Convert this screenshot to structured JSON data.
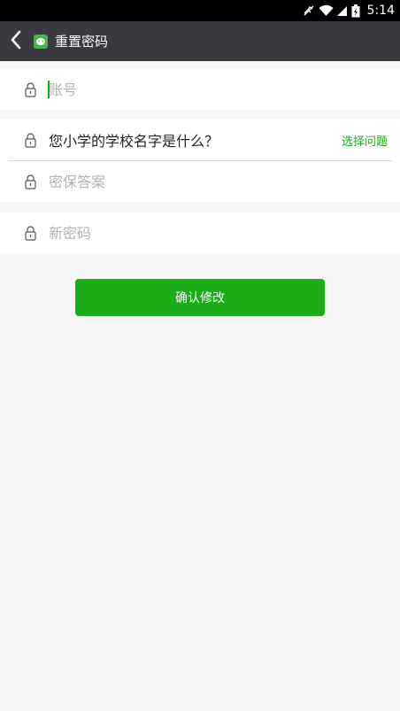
{
  "status_bar": {
    "time": "5:14",
    "icons": [
      "mute-icon",
      "wifi-icon",
      "signal-icon",
      "battery-icon"
    ]
  },
  "title_bar": {
    "title": "重置密码",
    "back_icon": "chevron-left-icon",
    "app_icon": "wechat-icon"
  },
  "form": {
    "account": {
      "placeholder": "账号",
      "value": ""
    },
    "question": {
      "text": "您小学的学校名字是什么？",
      "choose_label": "选择问题"
    },
    "answer": {
      "placeholder": "密保答案",
      "value": ""
    },
    "new_password": {
      "placeholder": "新密码",
      "value": ""
    }
  },
  "confirm_button": {
    "label": "确认修改"
  },
  "colors": {
    "accent": "#1aad19",
    "title_bar": "#393a3f",
    "background": "#f7f7f7"
  }
}
